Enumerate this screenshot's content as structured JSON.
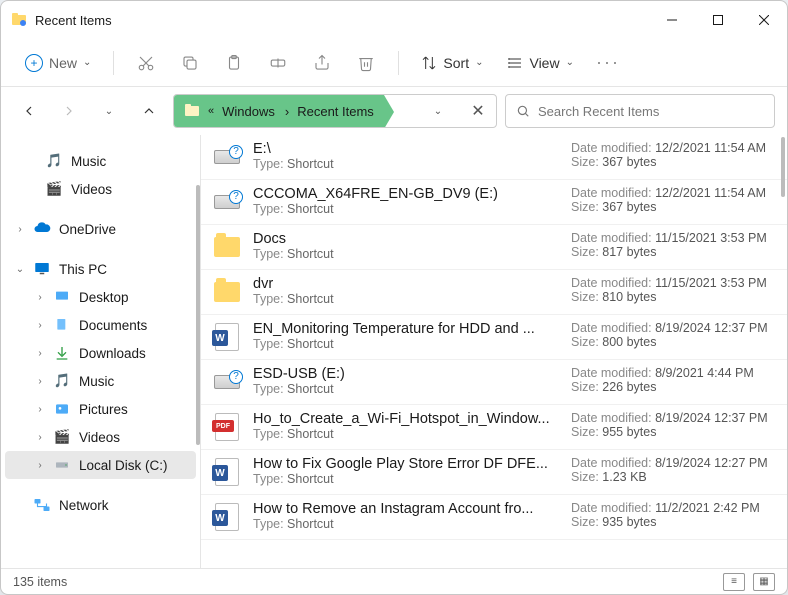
{
  "window_title": "Recent Items",
  "toolbar": {
    "new_label": "New",
    "sort_label": "Sort",
    "view_label": "View"
  },
  "breadcrumb": {
    "seg1": "Windows",
    "seg2": "Recent Items"
  },
  "search": {
    "placeholder": "Search Recent Items"
  },
  "sidebar": {
    "music": "Music",
    "videos": "Videos",
    "onedrive": "OneDrive",
    "thispc": "This PC",
    "desktop": "Desktop",
    "documents": "Documents",
    "downloads": "Downloads",
    "music2": "Music",
    "pictures": "Pictures",
    "videos2": "Videos",
    "localdisk": "Local Disk (C:)",
    "network": "Network"
  },
  "labels": {
    "type": "Type:",
    "date_modified": "Date modified:",
    "size": "Size:"
  },
  "items": [
    {
      "name": "E:\\",
      "type": "Shortcut",
      "date": "12/2/2021 11:54 AM",
      "size": "367 bytes",
      "icon": "drive-q"
    },
    {
      "name": "CCCOMA_X64FRE_EN-GB_DV9 (E:)",
      "type": "Shortcut",
      "date": "12/2/2021 11:54 AM",
      "size": "367 bytes",
      "icon": "drive-q"
    },
    {
      "name": "Docs",
      "type": "Shortcut",
      "date": "11/15/2021 3:53 PM",
      "size": "817 bytes",
      "icon": "folder"
    },
    {
      "name": "dvr",
      "type": "Shortcut",
      "date": "11/15/2021 3:53 PM",
      "size": "810 bytes",
      "icon": "folder"
    },
    {
      "name": "EN_Monitoring Temperature for HDD and ...",
      "type": "Shortcut",
      "date": "8/19/2024 12:37 PM",
      "size": "800 bytes",
      "icon": "word"
    },
    {
      "name": "ESD-USB (E:)",
      "type": "Shortcut",
      "date": "8/9/2021 4:44 PM",
      "size": "226 bytes",
      "icon": "drive-q"
    },
    {
      "name": "Ho_to_Create_a_Wi-Fi_Hotspot_in_Window...",
      "type": "Shortcut",
      "date": "8/19/2024 12:37 PM",
      "size": "955 bytes",
      "icon": "pdf"
    },
    {
      "name": "How to Fix Google Play Store Error DF DFE...",
      "type": "Shortcut",
      "date": "8/19/2024 12:27 PM",
      "size": "1.23 KB",
      "icon": "word"
    },
    {
      "name": "How to Remove an Instagram Account fro...",
      "type": "Shortcut",
      "date": "11/2/2021 2:42 PM",
      "size": "935 bytes",
      "icon": "word"
    }
  ],
  "status": {
    "count": "135 items"
  }
}
